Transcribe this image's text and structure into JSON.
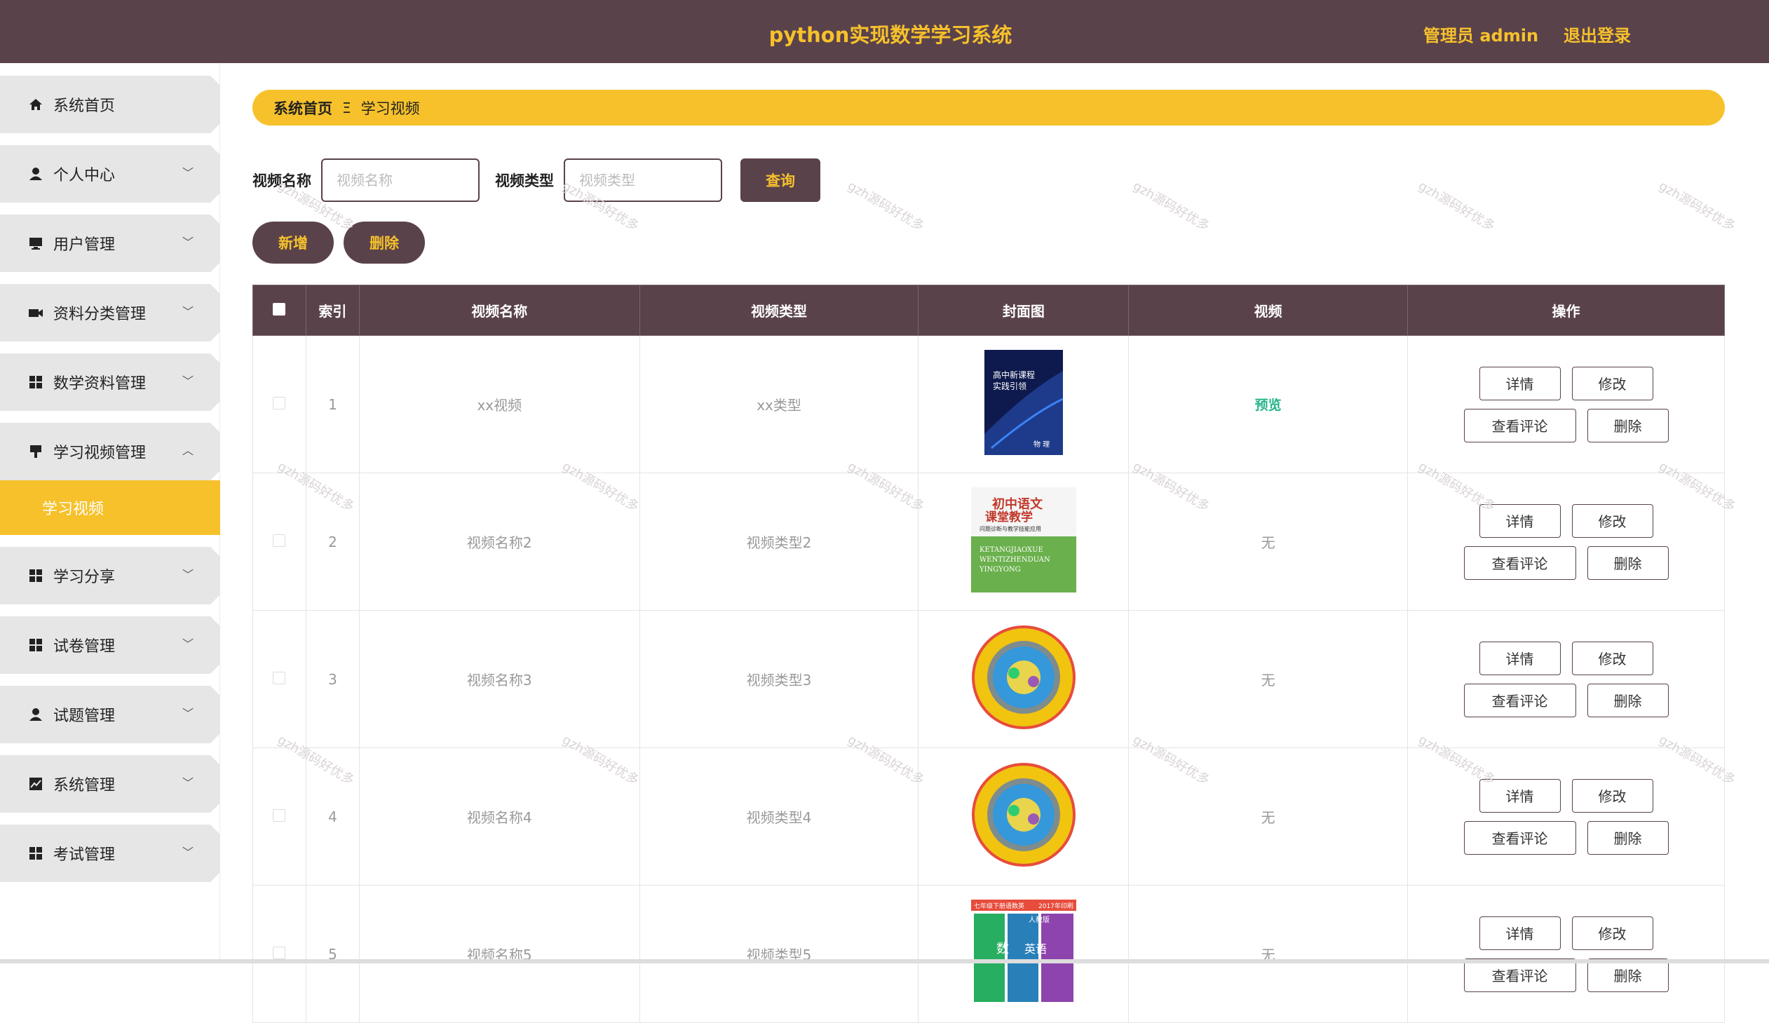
{
  "header": {
    "title": "python实现数学学习系统",
    "admin": "管理员 admin",
    "logout": "退出登录"
  },
  "sidebar": {
    "items": [
      {
        "label": "系统首页",
        "icon": "home-icon",
        "expandable": false
      },
      {
        "label": "个人中心",
        "icon": "user-icon",
        "expandable": true
      },
      {
        "label": "用户管理",
        "icon": "monitor-icon",
        "expandable": true
      },
      {
        "label": "资料分类管理",
        "icon": "video-camera-icon",
        "expandable": true
      },
      {
        "label": "数学资料管理",
        "icon": "grid-icon",
        "expandable": true
      },
      {
        "label": "学习视频管理",
        "icon": "flag-icon",
        "expandable": true,
        "open": true
      },
      {
        "label": "学习分享",
        "icon": "grid-icon",
        "expandable": true
      },
      {
        "label": "试卷管理",
        "icon": "grid-icon",
        "expandable": true
      },
      {
        "label": "试题管理",
        "icon": "user-icon",
        "expandable": true
      },
      {
        "label": "系统管理",
        "icon": "chart-icon",
        "expandable": true
      },
      {
        "label": "考试管理",
        "icon": "grid-icon",
        "expandable": true
      }
    ],
    "submenu": {
      "label": "学习视频"
    }
  },
  "breadcrumb": {
    "home": "系统首页",
    "sep": "Ξ",
    "current": "学习视频"
  },
  "search": {
    "name_label": "视频名称",
    "name_placeholder": "视频名称",
    "type_label": "视频类型",
    "type_placeholder": "视频类型",
    "query": "查询"
  },
  "actions": {
    "add": "新增",
    "delete": "删除"
  },
  "table": {
    "columns": [
      "索引",
      "视频名称",
      "视频类型",
      "封面图",
      "视频",
      "操作"
    ],
    "rows": [
      {
        "index": "1",
        "name": "xx视频",
        "type": "xx类型",
        "video": "预览",
        "video_link": true,
        "cover": "book-dark"
      },
      {
        "index": "2",
        "name": "视频名称2",
        "type": "视频类型2",
        "video": "无",
        "video_link": false,
        "cover": "book-green"
      },
      {
        "index": "3",
        "name": "视频名称3",
        "type": "视频类型3",
        "video": "无",
        "video_link": false,
        "cover": "circle"
      },
      {
        "index": "4",
        "name": "视频名称4",
        "type": "视频类型4",
        "video": "无",
        "video_link": false,
        "cover": "circle"
      },
      {
        "index": "5",
        "name": "视频名称5",
        "type": "视频类型5",
        "video": "无",
        "video_link": false,
        "cover": "book-color"
      }
    ],
    "ops": {
      "detail": "详情",
      "edit": "修改",
      "comments": "查看评论",
      "delete": "删除"
    }
  },
  "covers": {
    "book1": {
      "l1": "高中新课程",
      "l2": "实践引领",
      "l3": "物 理"
    },
    "book2": {
      "l1": "初中语文",
      "l2": "课堂教学",
      "l3": "问题诊断与教学技能应用",
      "l4": "KETANGJIAOXUE",
      "l5": "WENTIZHENDUAN",
      "l6": "YINGYONG"
    },
    "book5": {
      "l1": "七年级下册语数英",
      "l2": "2017年印刷",
      "l3": "人教版",
      "l4": "数",
      "l5": "英语"
    }
  },
  "watermark": "gzh源码好优多"
}
